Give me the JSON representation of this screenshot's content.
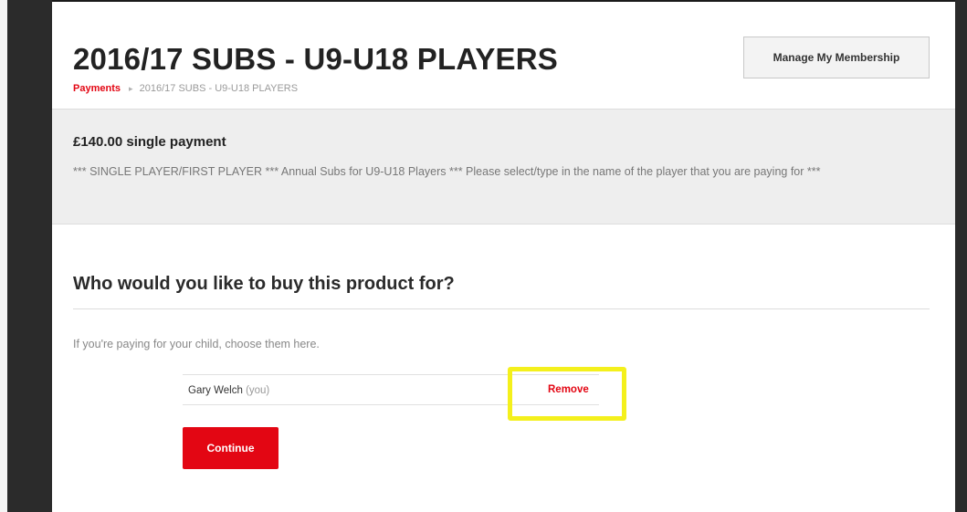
{
  "header": {
    "title": "2016/17 SUBS - U9-U18 PLAYERS",
    "breadcrumb": {
      "root": "Payments",
      "separator": "▸",
      "current": "2016/17 SUBS - U9-U18 PLAYERS"
    },
    "manage_button": "Manage My Membership"
  },
  "product": {
    "price": "£140.00 single payment",
    "description": "*** SINGLE PLAYER/FIRST PLAYER *** Annual Subs for U9-U18 Players *** Please select/type in the name of the player that you are paying for ***"
  },
  "buyer_section": {
    "heading": "Who would you like to buy this product for?",
    "helper": "If you're paying for your child, choose them here.",
    "member": {
      "name": "Gary Welch",
      "suffix": "(you)",
      "remove_label": "Remove"
    },
    "continue_label": "Continue"
  },
  "colors": {
    "accent": "#e30613",
    "highlight": "#f4f01c",
    "panel_bg": "#eeeeee",
    "frame": "#2b2b2b"
  }
}
